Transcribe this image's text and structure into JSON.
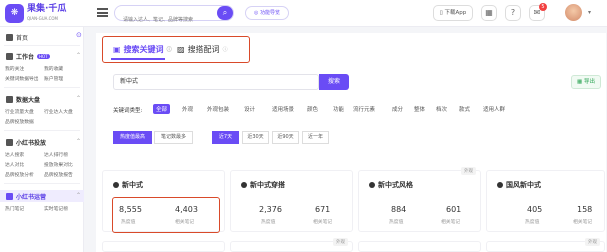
{
  "header": {
    "logo_text": "果集·千瓜",
    "logo_url": "QIAN-GUA.COM",
    "search_placeholder": "请输入达人、笔记、品牌等搜索",
    "func_button": "功能导览",
    "app_button": "下载App",
    "notification_count": "5"
  },
  "sidebar": {
    "home": "首页",
    "sections": [
      {
        "title": "工作台",
        "hot": "HOT",
        "items": [
          "我的关注",
          "我的收藏",
          "关键词数据导出",
          "账户管理"
        ]
      },
      {
        "title": "数据大盘",
        "items": [
          "行业流量大盘",
          "行业达人大盘",
          "品牌投放数据"
        ]
      },
      {
        "title": "小红书投放",
        "items": [
          "达人搜索",
          "达人排行榜",
          "达人对比",
          "投放效果对比",
          "品牌投放分析",
          "品牌投放报告"
        ]
      },
      {
        "title": "小红书运营",
        "items": [
          "热门笔记",
          "实时笔记榜"
        ]
      }
    ]
  },
  "tabs": [
    {
      "label": "搜索关键词",
      "icon": "chart-icon"
    },
    {
      "label": "搜搭配词",
      "icon": "tag-icon"
    }
  ],
  "keyword_input": "新中式",
  "search_button": "搜索",
  "export_button": "导出",
  "category_label": "关键词类型:",
  "categories": [
    "全部",
    "外观",
    "外观包装",
    "设计",
    "适用场景",
    "颜色",
    "功能",
    "流行元素",
    "成分",
    "整体",
    "档次",
    "款式",
    "适用人群"
  ],
  "sort_chips": [
    "热度值最高",
    "笔记数最多"
  ],
  "time_chips": [
    "近7天",
    "近30天",
    "近90天",
    "近一年"
  ],
  "cards": [
    {
      "title": "新中式",
      "heat": "8,555",
      "notes": "4,403",
      "heat_label": "热度值",
      "notes_label": "相关笔记",
      "tag": ""
    },
    {
      "title": "新中式穿搭",
      "heat": "2,376",
      "notes": "671",
      "heat_label": "热度值",
      "notes_label": "相关笔记",
      "tag": ""
    },
    {
      "title": "新中式风格",
      "heat": "884",
      "notes": "601",
      "heat_label": "热度值",
      "notes_label": "相关笔记",
      "tag": "外观"
    },
    {
      "title": "国风新中式",
      "heat": "405",
      "notes": "158",
      "heat_label": "热度值",
      "notes_label": "相关笔记",
      "tag": ""
    }
  ],
  "bottom_tags": [
    "外观",
    "外观"
  ],
  "colors": {
    "accent": "#6a4cf5",
    "highlight": "#d94a2a"
  }
}
